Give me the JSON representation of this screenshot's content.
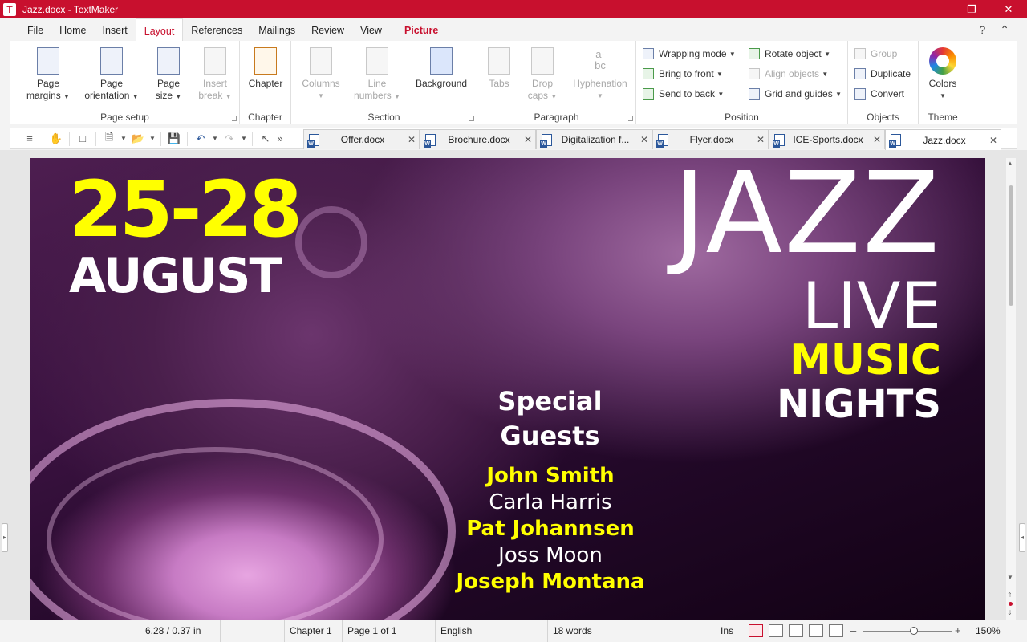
{
  "window": {
    "title": "Jazz.docx - TextMaker",
    "app_icon": "T"
  },
  "menu": {
    "items": [
      "File",
      "Home",
      "Insert",
      "Layout",
      "References",
      "Mailings",
      "Review",
      "View"
    ],
    "active": "Layout",
    "context_tab": "Picture",
    "help": "?",
    "collapse": "^"
  },
  "ribbon": {
    "page_setup": {
      "label": "Page setup",
      "page_margins": [
        "Page",
        "margins"
      ],
      "page_orientation": [
        "Page",
        "orientation"
      ],
      "page_size": [
        "Page",
        "size"
      ],
      "insert_break": [
        "Insert",
        "break"
      ]
    },
    "chapter": {
      "label": "Chapter",
      "button": "Chapter"
    },
    "section": {
      "label": "Section",
      "columns": "Columns",
      "line_numbers": [
        "Line",
        "numbers"
      ],
      "background": "Background"
    },
    "paragraph": {
      "label": "Paragraph",
      "tabs": "Tabs",
      "drop_caps": [
        "Drop",
        "caps"
      ],
      "hyphenation": "Hyphenation",
      "hyphen_glyph": "a-\nbc"
    },
    "position": {
      "label": "Position",
      "wrapping_mode": "Wrapping mode",
      "bring_to_front": "Bring to front",
      "send_to_back": "Send to back",
      "rotate_object": "Rotate object",
      "align_objects": "Align objects",
      "grid_and_guides": "Grid and guides"
    },
    "objects": {
      "label": "Objects",
      "group": "Group",
      "duplicate": "Duplicate",
      "convert": "Convert"
    },
    "theme": {
      "label": "Theme",
      "colors": "Colors"
    }
  },
  "doc_tabs": [
    {
      "label": "Offer.docx",
      "active": false
    },
    {
      "label": "Brochure.docx",
      "active": false
    },
    {
      "label": "Digitalization f...",
      "active": false
    },
    {
      "label": "Flyer.docx",
      "active": false
    },
    {
      "label": "ICE-Sports.docx",
      "active": false
    },
    {
      "label": "Jazz.docx",
      "active": true
    }
  ],
  "poster": {
    "dates": "25-28",
    "month": "AUGUST",
    "headline": "JAZZ",
    "line2": "LIVE",
    "line3": "MUSIC",
    "line4": "NIGHTS",
    "special_1": "Special",
    "special_2": "Guests",
    "guests": [
      "John Smith",
      "Carla Harris",
      "Pat Johannsen",
      "Joss Moon",
      "Joseph Montana"
    ]
  },
  "status": {
    "position": "6.28 / 0.37 in",
    "chapter": "Chapter 1",
    "page": "Page 1 of 1",
    "language": "English",
    "words": "18 words",
    "mode": "Ins",
    "zoom": "150%"
  },
  "colors": {
    "accent": "#c8102e",
    "poster_yellow": "#ffff00"
  }
}
